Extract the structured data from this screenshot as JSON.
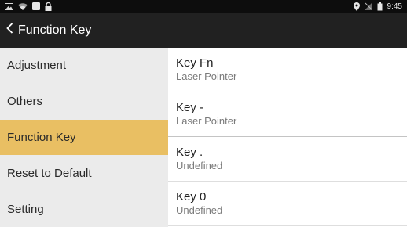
{
  "status": {
    "time": "9:45"
  },
  "header": {
    "title": "Function Key"
  },
  "sidebar": {
    "items": [
      {
        "label": "Adjustment"
      },
      {
        "label": "Others"
      },
      {
        "label": "Function Key"
      },
      {
        "label": "Reset to Default"
      },
      {
        "label": "Setting"
      }
    ]
  },
  "keys": [
    {
      "title": "Key Fn",
      "value": "Laser Pointer"
    },
    {
      "title": "Key -",
      "value": "Laser Pointer"
    },
    {
      "title": "Key .",
      "value": "Undefined"
    },
    {
      "title": "Key 0",
      "value": "Undefined"
    }
  ],
  "colors": {
    "active_sidebar": "#e9bf63",
    "app_bar": "#212121",
    "status_bar": "#0d0d0d"
  },
  "icons": {
    "status_left": [
      "image-icon",
      "wifi-icon",
      "square-icon",
      "lock-icon"
    ],
    "status_right": [
      "location-icon",
      "no-signal-icon",
      "battery-icon"
    ],
    "back": "chevron-left-icon"
  }
}
